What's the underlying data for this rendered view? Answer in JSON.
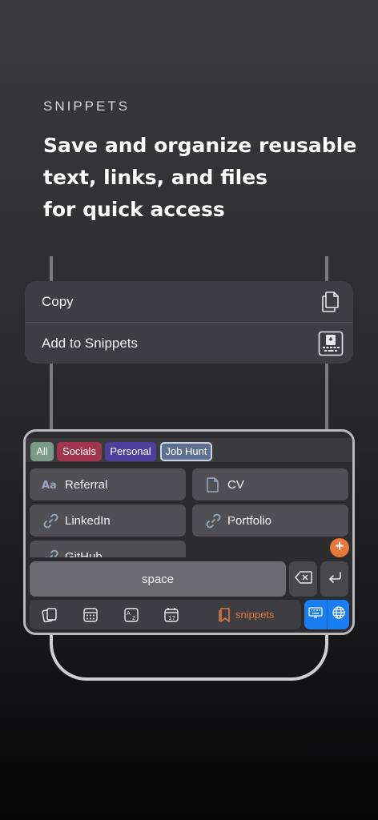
{
  "header": {
    "eyebrow": "SNIPPETS",
    "headline_lines": [
      "Save and organize reusable",
      "text, links, and files",
      "for quick access"
    ]
  },
  "context_menu": {
    "items": [
      {
        "label": "Copy",
        "icon": "copy-icon"
      },
      {
        "label": "Add to Snippets",
        "icon": "add-to-snippets-icon"
      }
    ]
  },
  "keyboard": {
    "tags": [
      {
        "label": "All",
        "color": "#7a9a8a"
      },
      {
        "label": "Socials",
        "color": "#a0354e"
      },
      {
        "label": "Personal",
        "color": "#4c3e9a"
      },
      {
        "label": "Job Hunt",
        "color": "#5e7090",
        "selected": true
      }
    ],
    "snippets": [
      {
        "label": "Referral",
        "icon": "text-icon"
      },
      {
        "label": "CV",
        "icon": "file-icon"
      },
      {
        "label": "LinkedIn",
        "icon": "link-icon"
      },
      {
        "label": "Portfolio",
        "icon": "link-icon"
      },
      {
        "label": "GitHub",
        "icon": "link-icon"
      }
    ],
    "add_label": "+",
    "space_label": "space",
    "bottom_tabs": [
      "clipboard-stack-icon",
      "calculator-icon",
      "translate-icon",
      "calendar-icon"
    ],
    "calendar_day": "17",
    "active_tab_label": "snippets",
    "accent_color": "#e07a3c",
    "switch_color": "#1a7ef0"
  }
}
